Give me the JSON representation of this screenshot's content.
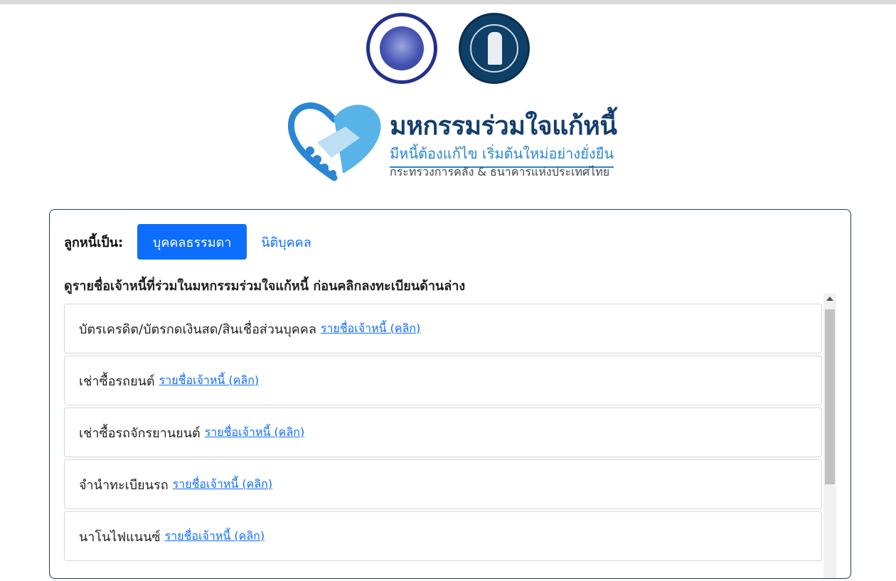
{
  "logos": {
    "mof_icon": "ministry-of-finance-seal",
    "bot_icon": "bank-of-thailand-seal"
  },
  "campaign": {
    "title": "มหกรรมร่วมใจแก้หนี้",
    "tagline": "มีหนี้ต้องแก้ไข เริ่มต้นใหม่อย่างยั่งยืน",
    "organizers": "กระทรวงการคลัง & ธนาคารแห่งประเทศไทย",
    "heart_colors": [
      "#2a86d3",
      "#58b3e8",
      "#bcdff4"
    ]
  },
  "debtor": {
    "label": "ลูกหนี้เป็น:",
    "options": [
      {
        "label": "บุคคลธรรมดา",
        "selected": true
      },
      {
        "label": "นิติบุคคล",
        "selected": false
      }
    ]
  },
  "instruction": "ดูรายชื่อเจ้าหนี้ที่ร่วมในมหกรรมร่วมใจแก้หนี้ ก่อนคลิกลงทะเบียนด้านล่าง",
  "categories": [
    {
      "name": "บัตรเครดิต/บัตรกดเงินสด/สินเชื่อส่วนบุคคล",
      "link": "รายชื่อเจ้าหนี้ (คลิก)"
    },
    {
      "name": "เช่าซื้อรถยนต์",
      "link": "รายชื่อเจ้าหนี้ (คลิก)"
    },
    {
      "name": "เช่าซื้อรถจักรยานยนต์",
      "link": "รายชื่อเจ้าหนี้ (คลิก)"
    },
    {
      "name": "จำนำทะเบียนรถ",
      "link": "รายชื่อเจ้าหนี้ (คลิก)"
    },
    {
      "name": "นาโนไฟแนนซ์",
      "link": "รายชื่อเจ้าหนี้ (คลิก)"
    }
  ],
  "colors": {
    "primary": "#0d6efd",
    "brand_navy": "#143e70",
    "card_border": "#1b3b61"
  }
}
